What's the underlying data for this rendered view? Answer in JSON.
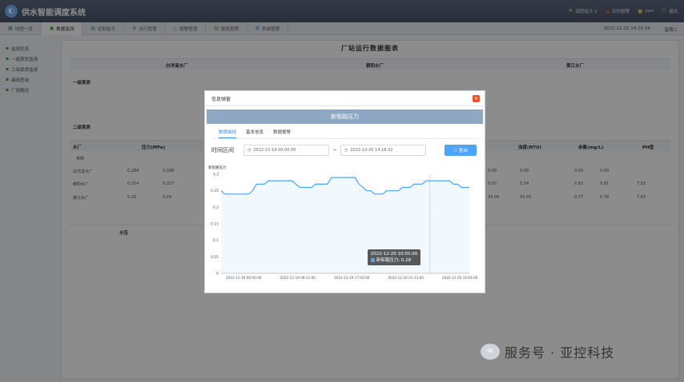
{
  "header": {
    "title": "供水智能调度系统",
    "right_items": [
      {
        "icon": "flag-icon",
        "label": "调度指令 2",
        "color": "#9ad03e"
      },
      {
        "icon": "alarm-icon",
        "label": "实时报警",
        "color": "#e8552b"
      },
      {
        "icon": "user-icon",
        "label": "zsm",
        "color": "#f2c744"
      },
      {
        "icon": "power-icon",
        "label": "退出",
        "color": "#9ad03e"
      }
    ]
  },
  "nav": {
    "items": [
      "地图一览",
      "数据监测",
      "控制指令",
      "运行管理",
      "报警管理",
      "报表管理",
      "系统管理"
    ],
    "active_index": 1,
    "datetime": "2022-12-20 14:20:36",
    "weekday": "星期二"
  },
  "sidebar": {
    "items": [
      "监测总览",
      "一级泵房监测",
      "二级泵房监测",
      "曲线查询",
      "厂网数控"
    ]
  },
  "main": {
    "title": "厂站运行数据图表",
    "station_headers": [
      "白洋溪水厂",
      "朝阳水厂",
      "黄江水厂"
    ],
    "left_rows": [
      "一级泵房",
      "二级泵房"
    ],
    "param_table": {
      "headers": [
        "水厂",
        "压力(MPa)",
        "浊度(NTU)",
        "余氯(mg/L)",
        "PH值"
      ],
      "sub_label": "参数",
      "rows": [
        {
          "name": "白洋溪水厂",
          "values": [
            "0.284",
            "0.288"
          ],
          "right": [
            "0.00",
            "0.00",
            "0.00",
            "0.00"
          ]
        },
        {
          "name": "朝阳水厂",
          "values": [
            "0.314",
            "0.317"
          ],
          "right": [
            "0.07",
            "0.54",
            "0.82",
            "0.81",
            "7.83"
          ]
        },
        {
          "name": "黄江水厂",
          "values": [
            "0.29",
            "0.29"
          ],
          "right": [
            "34.09",
            "43.65",
            "0.77",
            "0.78",
            "7.83"
          ]
        }
      ]
    },
    "lower_left_title": "水压"
  },
  "modal": {
    "header": "信息弹窗",
    "banner": "新街路压力",
    "tabs": [
      "数据曲线",
      "基本信息",
      "数据报警"
    ],
    "active_tab": 0,
    "range_label": "时间区间",
    "start": "2022-12-19 00:00:00",
    "end": "2022-12-20 14:18:32",
    "dash": "~",
    "query_label": "查询",
    "tooltip_time": "2022-12-20 10:05:00",
    "tooltip_value": "新街路压力: 0.28"
  },
  "chart_data": {
    "type": "line",
    "title": "",
    "ylabel": "新街路压力",
    "ylim": [
      0,
      0.3
    ],
    "yticks": [
      "0.3",
      "0.25",
      "0.2",
      "0.15",
      "0.1",
      "0.05",
      "0"
    ],
    "xticks": [
      "2022-12-19 00:00:00",
      "2022-12-19 08:31:00",
      "2022-12-19 17:02:00",
      "2022-12-20 01:33:00",
      "2022-12-20 10:04:00"
    ],
    "series": [
      {
        "color": "#4da3f7",
        "values": [
          0.25,
          0.24,
          0.24,
          0.24,
          0.24,
          0.24,
          0.24,
          0.24,
          0.25,
          0.27,
          0.27,
          0.27,
          0.28,
          0.28,
          0.28,
          0.28,
          0.28,
          0.28,
          0.28,
          0.27,
          0.26,
          0.26,
          0.26,
          0.26,
          0.27,
          0.27,
          0.27,
          0.27,
          0.29,
          0.29,
          0.29,
          0.29,
          0.29,
          0.29,
          0.29,
          0.27,
          0.26,
          0.25,
          0.25,
          0.24,
          0.24,
          0.24,
          0.25,
          0.25,
          0.25,
          0.25,
          0.26,
          0.26,
          0.26,
          0.27,
          0.27,
          0.27,
          0.28,
          0.28,
          0.28,
          0.28,
          0.28,
          0.28,
          0.28,
          0.27,
          0.27,
          0.26,
          0.26,
          0.26
        ]
      }
    ],
    "tooltip_index": 53
  },
  "watermark": {
    "text": "服务号 · 亚控科技"
  }
}
